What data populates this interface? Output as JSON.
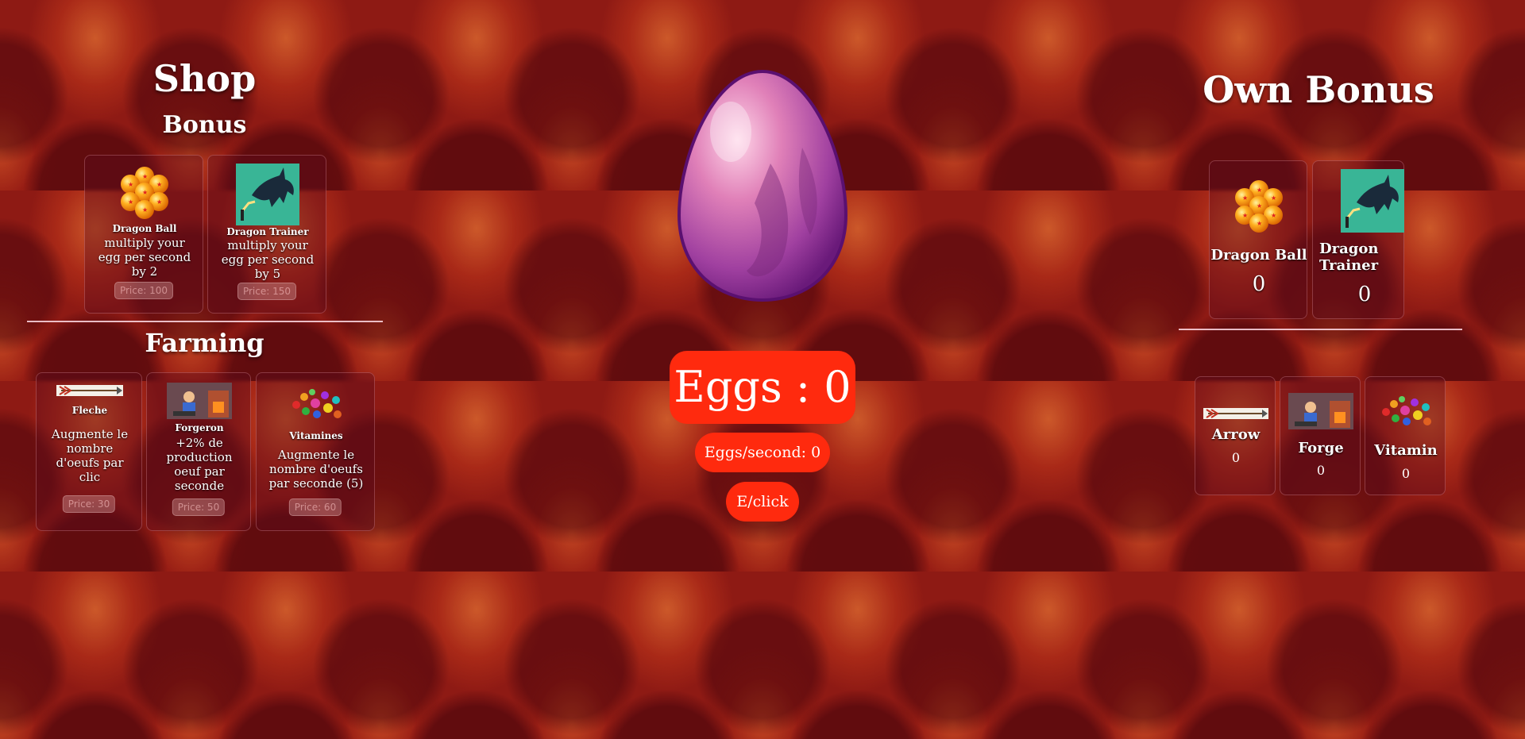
{
  "shop": {
    "title": "Shop",
    "bonus_title": "Bonus",
    "bonus_items": [
      {
        "name": "Dragon Ball",
        "desc": "multiply your egg per second by 2",
        "price": "Price: 100",
        "icon": "dragon-balls-icon"
      },
      {
        "name": "Dragon Trainer",
        "desc": "multiply your egg per second by 5",
        "price": "Price: 150",
        "icon": "dragon-trainer-icon"
      }
    ],
    "farming_title": "Farming",
    "farming_items": [
      {
        "name": "Fleche",
        "desc": "Augmente le nombre d'oeufs par clic",
        "price": "Price: 30",
        "icon": "arrow-icon"
      },
      {
        "name": "Forgeron",
        "desc": "+2% de production oeuf par seconde",
        "price": "Price: 50",
        "icon": "forge-icon"
      },
      {
        "name": "Vitamines",
        "desc": "Augmente le nombre d'oeufs par seconde (5)",
        "price": "Price: 60",
        "icon": "vitamins-icon"
      }
    ]
  },
  "center": {
    "egg_icon": "dragon-egg-icon",
    "eggs_label": "Eggs : 0",
    "eps_label": "Eggs/second: 0",
    "click_label": "E/click"
  },
  "own": {
    "title": "Own Bonus",
    "bonus_items": [
      {
        "name": "Dragon Ball",
        "count": "0"
      },
      {
        "name": "Dragon Trainer",
        "count": "0"
      }
    ],
    "farming_items": [
      {
        "name": "Arrow",
        "count": "0"
      },
      {
        "name": "Forge",
        "count": "0"
      },
      {
        "name": "Vitamin",
        "count": "0"
      }
    ]
  },
  "colors": {
    "accent": "#ff2a0e",
    "background": "#8e1a14"
  }
}
